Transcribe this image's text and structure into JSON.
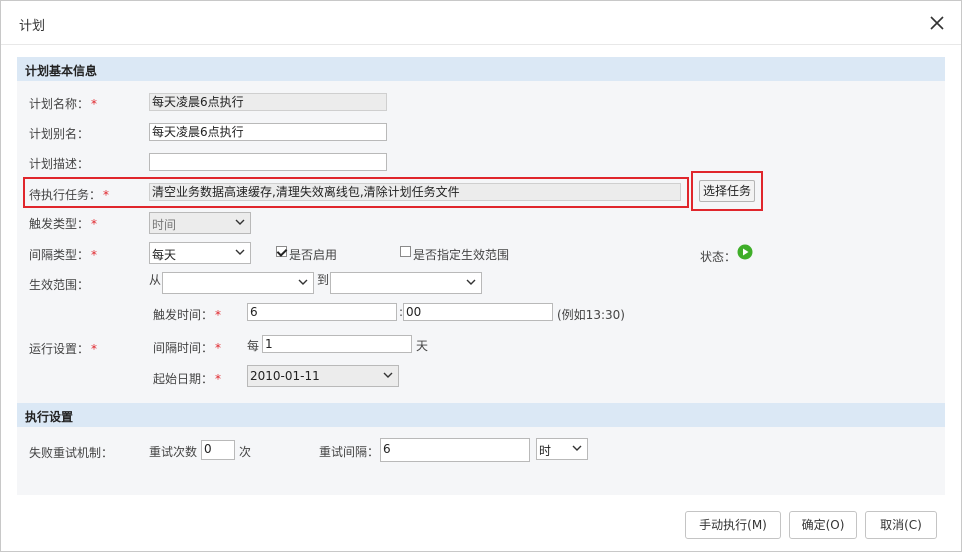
{
  "dialog": {
    "title": "计划"
  },
  "basic": {
    "section_title": "计划基本信息",
    "name_label": "计划名称：",
    "name_value": "每天凌晨6点执行",
    "alias_label": "计划别名：",
    "alias_value": "每天凌晨6点执行",
    "desc_label": "计划描述：",
    "desc_value": "",
    "task_label": "待执行任务：",
    "task_value": "清空业务数据高速缓存,清理失效离线包,清除计划任务文件",
    "select_task_button": "选择任务",
    "trigger_label": "触发类型：",
    "trigger_value": "时间",
    "interval_label": "间隔类型：",
    "interval_value": "每天",
    "enabled_label": "是否启用",
    "effective_checkbox_label": "是否指定生效范围",
    "status_label": "状态：",
    "range_label": "生效范围：",
    "from_label": "从",
    "to_label": "到",
    "trigger_time_label": "触发时间：",
    "hour_value": "6",
    "colon": ":",
    "minute_value": "00",
    "time_example": "(例如13:30)",
    "run_settings_label": "运行设置：",
    "interval_time_label": "间隔时间：",
    "every_label": "每",
    "interval_days_value": "1",
    "days_unit": "天",
    "start_date_label": "起始日期：",
    "start_date_value": "2010-01-11",
    "required_mark": "*"
  },
  "exec": {
    "section_title": "执行设置",
    "retry_label": "失败重试机制：",
    "retry_count_label": "重试次数",
    "retry_count_value": "0",
    "retry_count_unit": "次",
    "retry_interval_label": "重试间隔：",
    "retry_interval_value": "6",
    "retry_interval_unit": "时"
  },
  "footer": {
    "run_button": "手动执行(M)",
    "ok_button": "确定(O)",
    "cancel_button": "取消(C)"
  },
  "colors": {
    "accent_red": "#e0262c",
    "section_bg": "#dbe8f5",
    "status_green": "#3fae29"
  }
}
